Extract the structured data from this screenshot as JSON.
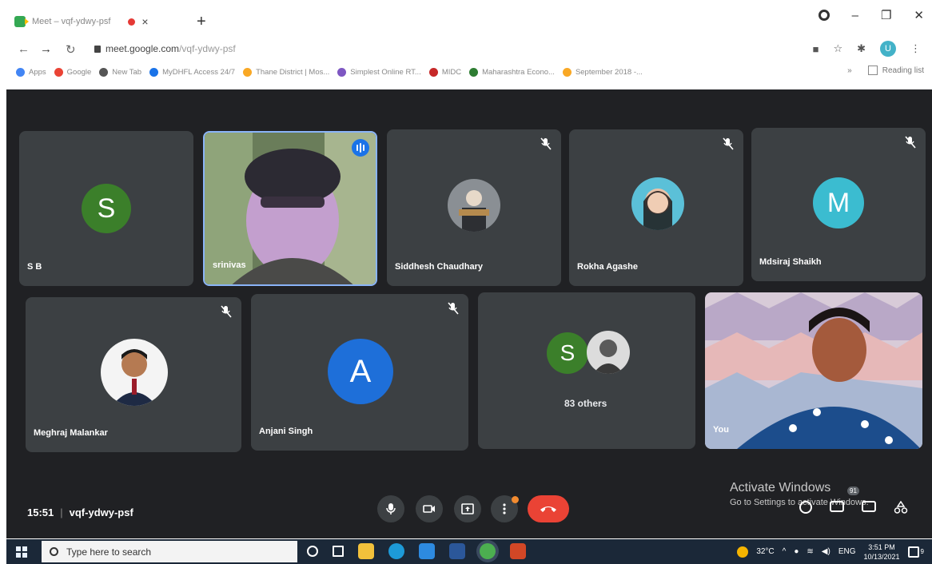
{
  "browser": {
    "tab_title": "Meet – vqf-ydwy-psf",
    "tab_close": "×",
    "new_tab": "+",
    "url_host": "meet.google.com",
    "url_path": "/vqf-ydwy-psf",
    "profile_initial": "U",
    "bookmarks": [
      {
        "label": "Apps",
        "color": "#4285f4"
      },
      {
        "label": "Google",
        "color": "#ea4335"
      },
      {
        "label": "New Tab",
        "color": "#555555"
      },
      {
        "label": "MyDHFL Access 24/7",
        "color": "#1a73e8"
      },
      {
        "label": "Thane District | Mos...",
        "color": "#f9a825"
      },
      {
        "label": "Simplest Online RT...",
        "color": "#7e57c2"
      },
      {
        "label": "MIDC",
        "color": "#c62828"
      },
      {
        "label": "Maharashtra Econo...",
        "color": "#2e7d32"
      },
      {
        "label": "September 2018 -...",
        "color": "#f9a825"
      }
    ],
    "bookmarks_overflow": "»",
    "reading_list": "Reading list"
  },
  "meeting": {
    "time": "15:51",
    "code": "vqf-ydwy-psf",
    "participants": [
      {
        "name": "S B",
        "initial": "S",
        "color": "#3b7f2a",
        "muted": false
      },
      {
        "name": "srinivas",
        "video": true,
        "speaking": true
      },
      {
        "name": "Siddhesh Chaudhary",
        "photo": true,
        "muted": true
      },
      {
        "name": "Rokha Agashe",
        "photo": true,
        "muted": true
      },
      {
        "name": "Mdsiraj Shaikh",
        "initial": "M",
        "color": "#3bbcd0",
        "muted": true
      },
      {
        "name": "Meghraj Malankar",
        "photo": true,
        "muted": true
      },
      {
        "name": "Anjani Singh",
        "initial": "A",
        "color": "#1e6fd9",
        "muted": true
      },
      {
        "name": "You",
        "video": true
      }
    ],
    "others": {
      "initial": "S",
      "color": "#3b7f2a",
      "label": "83 others"
    },
    "people_count": "91"
  },
  "watermark": {
    "title": "Activate Windows",
    "subtitle": "Go to Settings to activate Windows."
  },
  "taskbar": {
    "search_placeholder": "Type here to search",
    "temperature": "32°C",
    "language": "ENG",
    "time": "3:51 PM",
    "date": "10/13/2021",
    "notification_count": "9"
  }
}
